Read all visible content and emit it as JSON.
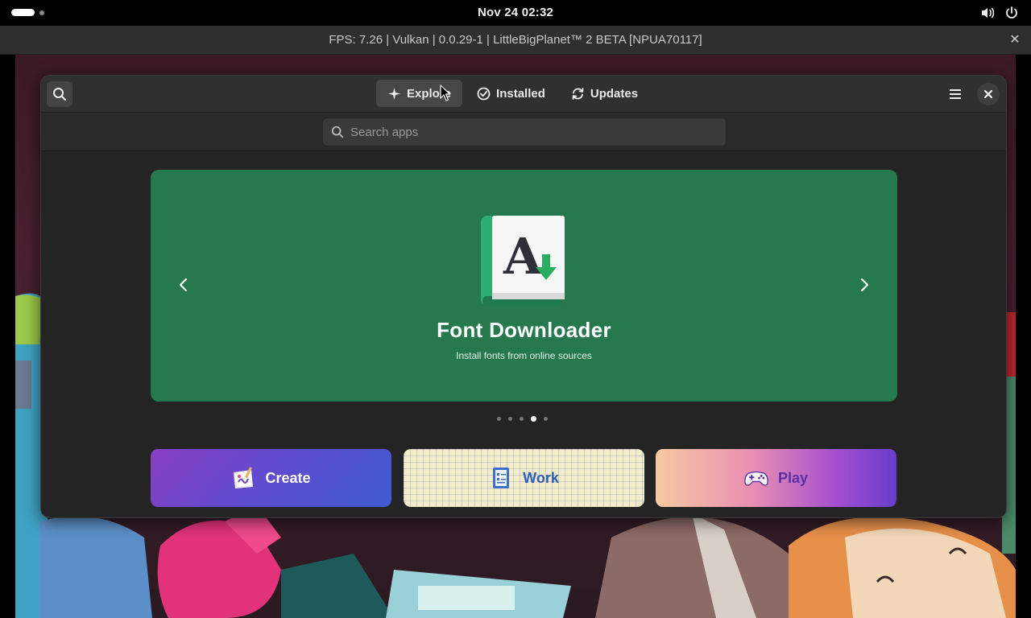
{
  "topbar": {
    "clock": "Nov 24  02:32",
    "volume_icon": "volume-icon",
    "power_icon": "power-icon"
  },
  "game_window": {
    "title": "FPS: 7.26 | Vulkan | 0.0.29-1 | LittleBigPlanet™ 2 BETA [NPUA70117]",
    "close_glyph": "✕"
  },
  "app": {
    "tabs": [
      {
        "label": "Explore",
        "icon": "sparkle-icon",
        "active": true
      },
      {
        "label": "Installed",
        "icon": "check-circle-icon",
        "active": false
      },
      {
        "label": "Updates",
        "icon": "refresh-icon",
        "active": false
      }
    ],
    "search": {
      "placeholder": "Search apps",
      "value": ""
    },
    "featured": {
      "title": "Font Downloader",
      "subtitle": "Install fonts from online sources",
      "icon": "font-downloader-icon",
      "icon_letter": "A",
      "color": "#26784f",
      "slide_count": 5,
      "active_slide": 4
    },
    "categories": [
      {
        "label": "Create",
        "icon": "palette-icon"
      },
      {
        "label": "Work",
        "icon": "checklist-icon"
      },
      {
        "label": "Play",
        "icon": "gamepad-icon"
      }
    ]
  }
}
